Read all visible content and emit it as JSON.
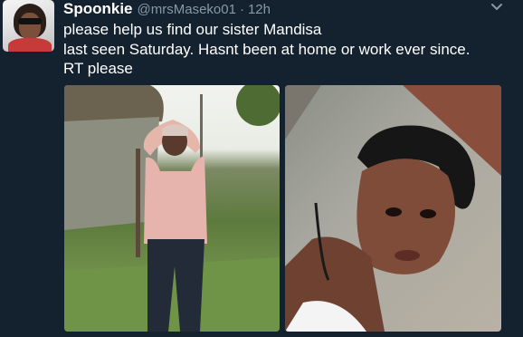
{
  "tweet": {
    "display_name": "Spoonkie",
    "handle": "@mrsMaseko01",
    "separator": "·",
    "time": "12h",
    "text_lines": [
      "please help us find our sister Mandisa",
      "last seen Saturday. Hasnt been at home or work ever since.",
      "RT please"
    ]
  },
  "icons": {
    "more": "chevron-down-icon"
  },
  "colors": {
    "background": "#14212e",
    "secondary_text": "#8899a6",
    "primary_text": "#ffffff"
  }
}
